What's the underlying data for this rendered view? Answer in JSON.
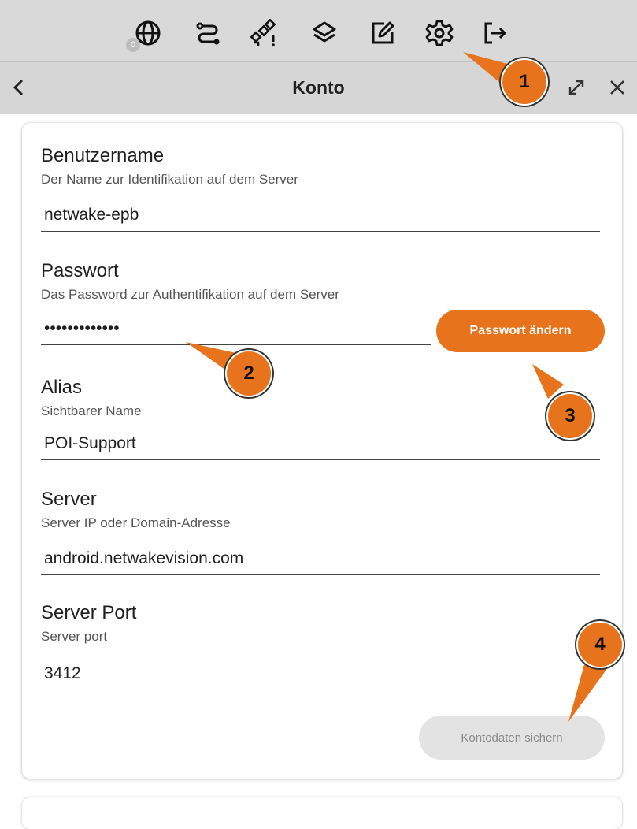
{
  "toolbar": {
    "items": [
      {
        "name": "globe-icon",
        "badge": "0"
      },
      {
        "name": "route-icon"
      },
      {
        "name": "satellite-warning-icon"
      },
      {
        "name": "layers-icon"
      },
      {
        "name": "edit-icon"
      },
      {
        "name": "gear-icon"
      },
      {
        "name": "logout-icon"
      }
    ]
  },
  "header": {
    "title": "Konto"
  },
  "form": {
    "username": {
      "label": "Benutzername",
      "description": "Der Name zur Identifikation auf dem Server",
      "value": "netwake-epb"
    },
    "password": {
      "label": "Passwort",
      "description": "Das Password zur Authentifikation auf dem Server",
      "value": "•••••••••••••",
      "change_button": "Passwort ändern"
    },
    "alias": {
      "label": "Alias",
      "description": "Sichtbarer Name",
      "value": "POI-Support"
    },
    "server": {
      "label": "Server",
      "description": "Server IP oder Domain-Adresse",
      "value": "android.netwakevision.com"
    },
    "port": {
      "label": "Server Port",
      "description": "Server port",
      "value": "3412"
    },
    "save_button": "Kontodaten sichern"
  },
  "callouts": [
    "1",
    "2",
    "3",
    "4"
  ],
  "colors": {
    "accent": "#e8731d",
    "toolbar_bg": "#d9d9d9",
    "disabled_button": "#e3e3e3"
  }
}
